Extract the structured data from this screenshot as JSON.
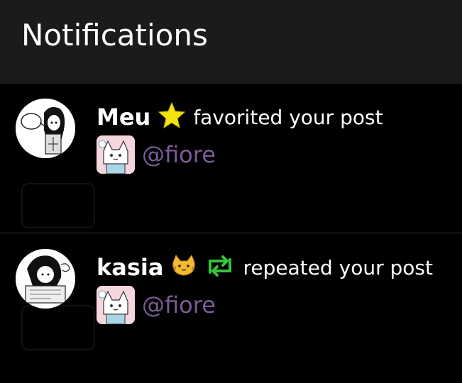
{
  "header": {
    "title": "Notifications"
  },
  "notifications": [
    {
      "username": "Meu",
      "action_icon": "star-icon",
      "action_text": "favorited your post",
      "target_handle": "@fiore"
    },
    {
      "username": "kasia",
      "user_emoji": "cat-emoji-icon",
      "action_icon": "repeat-icon",
      "action_text": "repeated your post",
      "target_handle": "@fiore"
    }
  ],
  "colors": {
    "header_bg": "#1b1b1b",
    "background": "#000000",
    "handle": "#7a5c97",
    "star": "#f4e20c",
    "repeat": "#34c33b"
  }
}
